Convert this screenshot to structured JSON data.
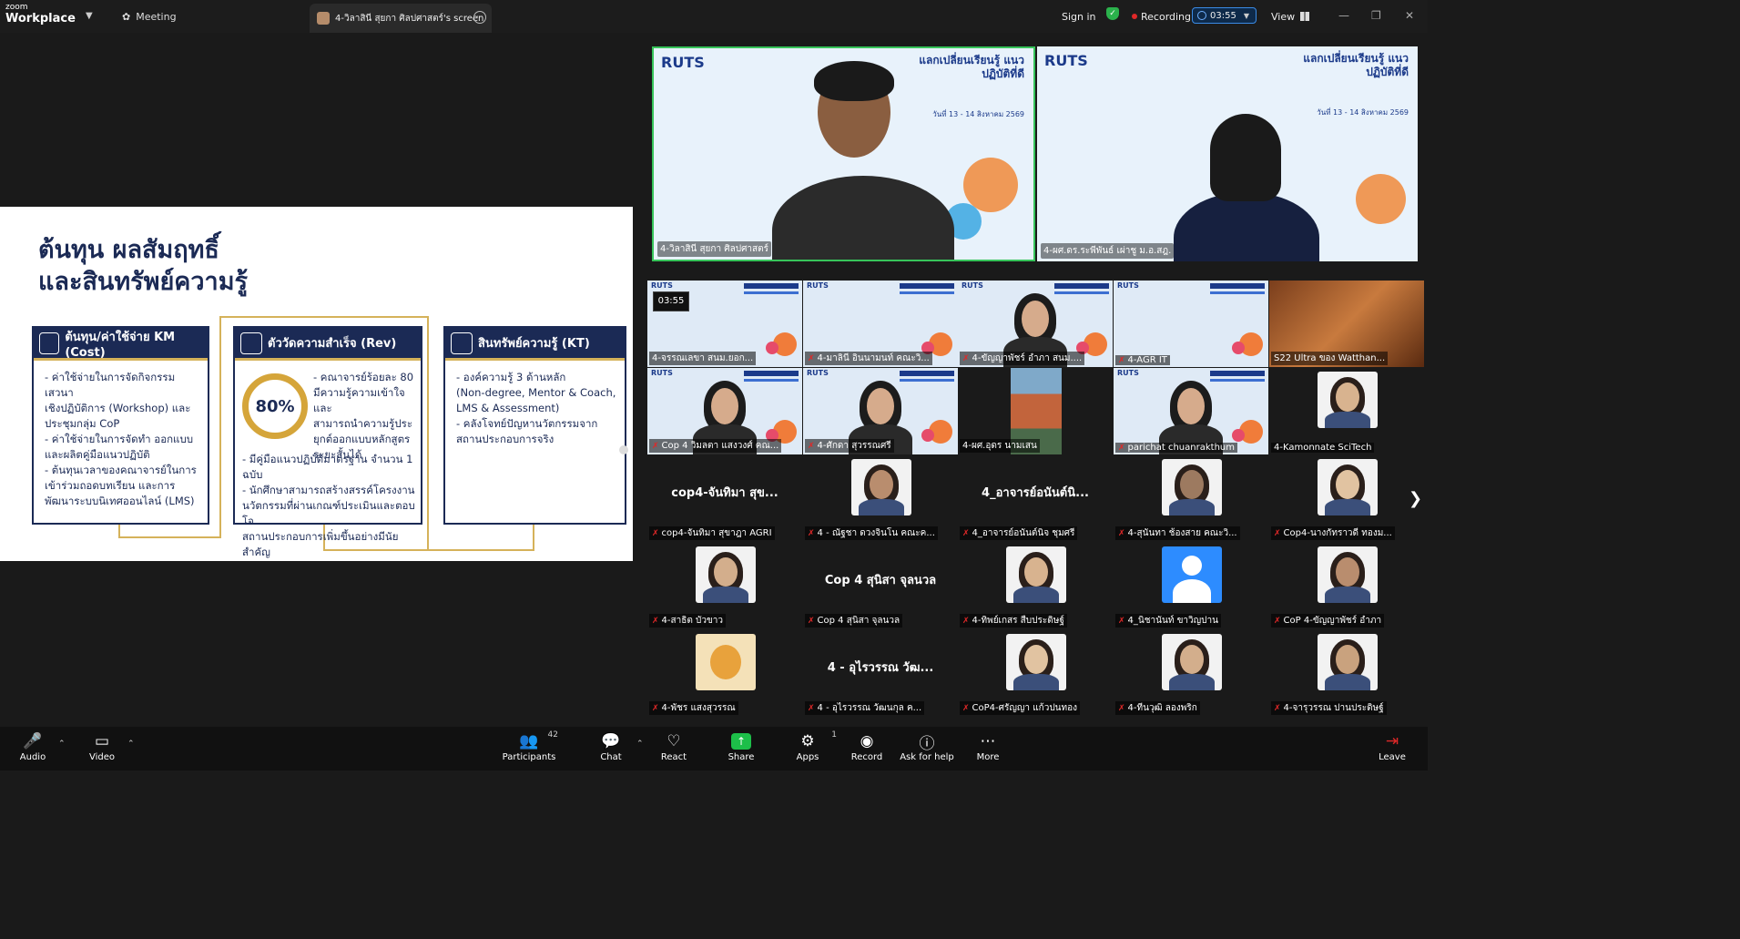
{
  "titlebar": {
    "logo_top": "zoom",
    "logo_bottom": "Workplace",
    "meeting_label": "Meeting",
    "tab_title": "4-วิลาสินี สุยกา ศิลปศาสตร์'s screen",
    "signin": "Sign in",
    "recording": "Recording",
    "timer": "03:55",
    "view": "View"
  },
  "slide": {
    "title_line1": "ต้นทุน ผลสัมฤทธิ์",
    "title_line2": "และสินทรัพย์ความรู้",
    "cards": [
      {
        "heading": "ต้นทุน/ค่าใช้จ่าย KM (Cost)",
        "icon": "calculator-icon",
        "items": [
          "- ค่าใช้จ่ายในการจัดกิจกรรมเสวนา",
          "  เชิงปฏิบัติการ (Workshop) และ",
          "  ประชุมกลุ่ม CoP",
          "- ค่าใช้จ่ายในการจัดทำ ออกแบบ",
          "  และผลิตคู่มือแนวปฏิบัติ",
          "- ต้นทุนเวลาของคณาจารย์ในการ",
          "  เข้าร่วมถอดบทเรียน และการ",
          "  พัฒนาระบบนิเทศออนไลน์ (LMS)"
        ]
      },
      {
        "heading": "ตัววัดความสำเร็จ (Rev)",
        "icon": "growth-chart-icon",
        "percent": "80%",
        "percent_value": 80,
        "top_items": [
          "- คณาจารย์ร้อยละ 80",
          "มีความรู้ความเข้าใจและ",
          "สามารถนำความรู้ประ",
          "ยุกต์ออกแบบหลักสูตร",
          "ระยะสั้นได้"
        ],
        "bottom_items": [
          "- มีคู่มือแนวปฏิบัติมาตรฐาน จำนวน 1 ฉบับ",
          "- นักศึกษาสามารถสร้างสรรค์โครงงาน",
          "  นวัตกรรมที่ผ่านเกณฑ์ประเมินและตอบโจ",
          "  สถานประกอบการเพิ่มขึ้นอย่างมีนัยสำคัญ"
        ]
      },
      {
        "heading": "สินทรัพย์ความรู้ (KT)",
        "icon": "book-icon",
        "items": [
          "- องค์ความรู้ 3 ด้านหลัก",
          "  (Non-degree, Mentor & Coach,",
          "  LMS & Assessment)",
          "- คลังโจทย์ปัญหานวัตกรรมจาก",
          "  สถานประกอบการจริง"
        ]
      }
    ]
  },
  "speakers": [
    {
      "name": "4-วิลาสินี สุยกา ศิลปศาสตร์",
      "banner": "แลกเปลี่ยนเรียนรู้ แนวปฏิบัติที่ดี",
      "ruts": "RUTS",
      "date": "วันที่ 13 - 14 สิงหาคม 2569"
    },
    {
      "name": "4-ผศ.ดร.ระพีพันธ์ เผ่าชู ม.อ.สฎ.",
      "banner": "แลกเปลี่ยนเรียนรู้ แนวปฏิบัติที่ดี",
      "ruts": "RUTS",
      "date": "วันที่ 13 - 14 สิงหาคม 2569"
    }
  ],
  "tile_timer": "03:55",
  "tiles": [
    {
      "name": "4-จรรณเลขา  สนม.ยอก...",
      "type": "ruts",
      "muted": false
    },
    {
      "name": "4-มาลินี อินนามนท์ คณะวิ...",
      "type": "ruts",
      "muted": true
    },
    {
      "name": "4-ขัญญาพัชร์ อำภา สนม....",
      "type": "ruts-person",
      "muted": true
    },
    {
      "name": "4-AGR IT",
      "type": "ruts",
      "muted": true
    },
    {
      "name": "S22 Ultra ของ Watthan...",
      "type": "room",
      "muted": false
    },
    {
      "name": "Cop 4 วิมลตา แสงวงศ์ คณ...",
      "type": "ruts-person",
      "muted": true
    },
    {
      "name": "4-ศักดา สุวรรณศรี",
      "type": "ruts-person",
      "muted": true
    },
    {
      "name": "4-ผศ.อุดร นามเสน",
      "type": "landscape",
      "muted": false
    },
    {
      "name": "parichat chuanrakthum",
      "type": "ruts-person",
      "muted": true
    },
    {
      "name": "4-Kamonnate SciTech",
      "type": "avatar",
      "muted": false
    },
    {
      "name": "cop4-จันทิมา สุขาฎา AGRI",
      "big": "cop4-จันทิมา สุข...",
      "type": "text",
      "muted": true
    },
    {
      "name": "4 - ณัฐชา ดวงจินโน คณะค...",
      "type": "avatar",
      "muted": true
    },
    {
      "name": "4_อาจารย์อนันต์นิจ ชุมศรี",
      "big": "4_อาจารย์อนันต์นิ...",
      "type": "text",
      "muted": true
    },
    {
      "name": "4-สุนันทา ช้องสาย คณะวิ...",
      "type": "avatar",
      "muted": true
    },
    {
      "name": "Cop4-นางกัทราวดี  ทองม...",
      "type": "avatar",
      "muted": true
    },
    {
      "name": "4-สาธิต บัวขาว",
      "type": "avatar",
      "muted": true
    },
    {
      "name": "Cop 4 สุนิสา จุลนวล",
      "big": "Cop 4 สุนิสา จุลนวล",
      "type": "text",
      "muted": true
    },
    {
      "name": "4-ทิพย์เกสร สืบประดิษฐ์",
      "type": "avatar",
      "muted": true
    },
    {
      "name": "4_นิชานันท์ ขาวิญปาน",
      "type": "default-avatar",
      "muted": true
    },
    {
      "name": "CoP 4-ขัญญาพัชร์ อำภา",
      "type": "avatar",
      "muted": true
    },
    {
      "name": "4-พัชร แสงสุวรรณ",
      "type": "cartoon",
      "muted": true
    },
    {
      "name": "4 - อุไรวรรณ วัฒนกุล ค...",
      "big": "4 - อุไรวรรณ วัฒ...",
      "type": "text",
      "muted": true
    },
    {
      "name": "CoP4-ศรัญญา แก้วปนทอง",
      "type": "avatar",
      "muted": true
    },
    {
      "name": "4-ทีนวุฒิ ลองพริก",
      "type": "avatar",
      "muted": true
    },
    {
      "name": "4-จารุวรรณ ปานประดิษฐ์",
      "type": "avatar",
      "muted": true
    }
  ],
  "toolbar": {
    "audio": "Audio",
    "video": "Video",
    "participants": "Participants",
    "participants_count": "42",
    "chat": "Chat",
    "react": "React",
    "share": "Share",
    "apps": "Apps",
    "apps_count": "1",
    "record": "Record",
    "ask_for_help": "Ask for help",
    "more": "More",
    "leave": "Leave"
  },
  "colors": {
    "navy": "#1b2a55",
    "gold": "#d5b25a",
    "active_border": "#37c45a",
    "share_green": "#1dbf49",
    "mute_red": "#e02828"
  }
}
